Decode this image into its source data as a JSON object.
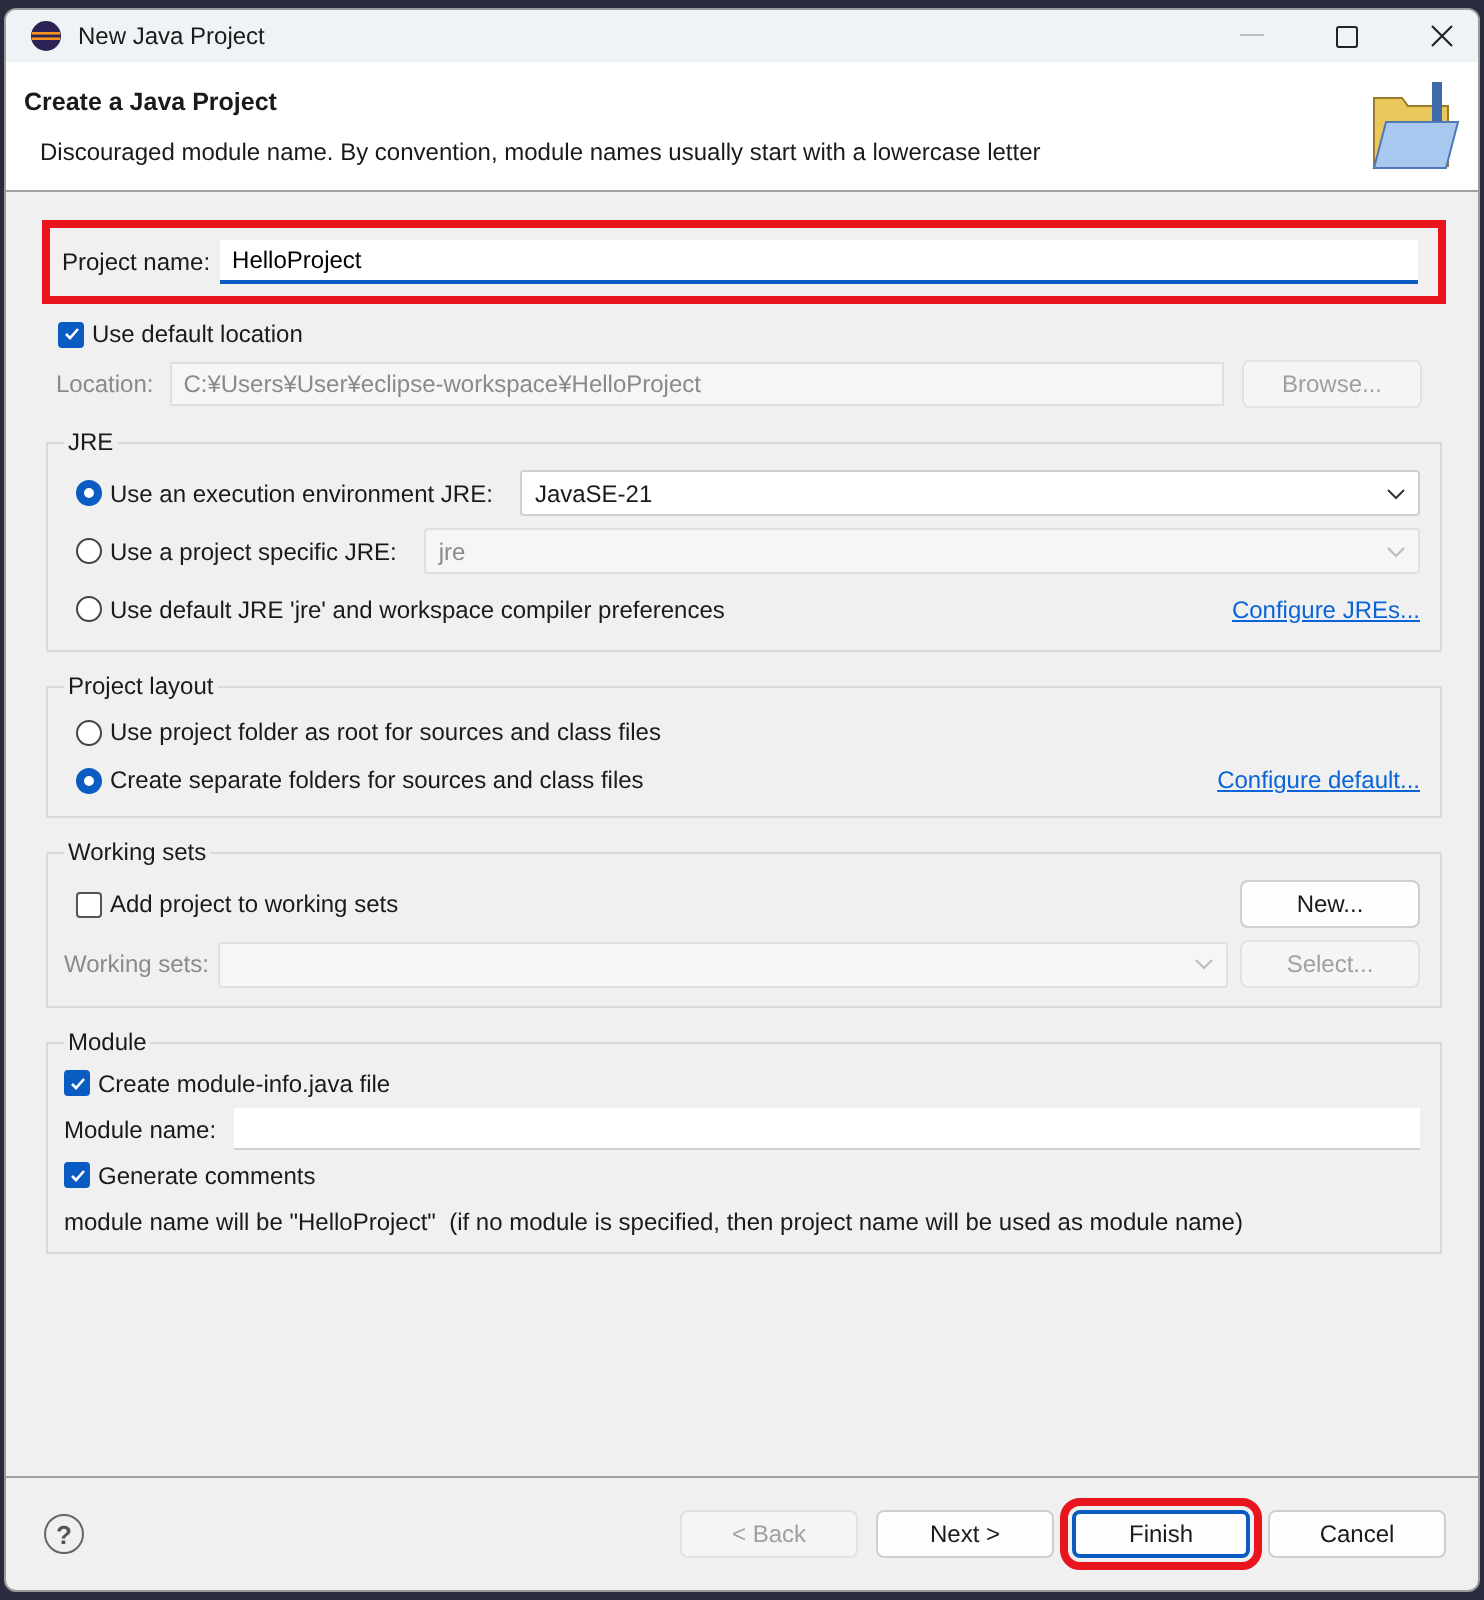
{
  "window": {
    "title": "New Java Project"
  },
  "header": {
    "title": "Create a Java Project",
    "message": "Discouraged module name. By convention, module names usually start with a lowercase letter"
  },
  "project_name": {
    "label": "Project name:",
    "value": "HelloProject",
    "highlighted": true
  },
  "default_location": {
    "label": "Use default location",
    "checked": true
  },
  "location": {
    "label": "Location:",
    "value": "C:¥Users¥User¥eclipse-workspace¥HelloProject",
    "disabled": true,
    "button": "Browse..."
  },
  "jre": {
    "title": "JRE",
    "options": [
      {
        "kind": "combo",
        "label": "Use an execution environment JRE:",
        "selected": true,
        "value": "JavaSE-21",
        "disabled": false
      },
      {
        "kind": "combo",
        "label": "Use a project specific JRE:",
        "selected": false,
        "value": "jre",
        "disabled": true
      },
      {
        "kind": "link",
        "label": "Use default JRE 'jre' and workspace compiler preferences",
        "selected": false,
        "link": "Configure JREs..."
      }
    ]
  },
  "layout": {
    "title": "Project layout",
    "options": [
      {
        "kind": "plain",
        "label": "Use project folder as root for sources and class files",
        "selected": false
      },
      {
        "kind": "link",
        "label": "Create separate folders for sources and class files",
        "selected": true,
        "link": "Configure default..."
      }
    ]
  },
  "working_sets": {
    "title": "Working sets",
    "add": {
      "label": "Add project to working sets",
      "checked": false
    },
    "new_button": "New...",
    "sets_label": "Working sets:",
    "disabled": true,
    "select_button": "Select..."
  },
  "module": {
    "title": "Module",
    "create": {
      "label": "Create module-info.java file",
      "checked": true
    },
    "name_label": "Module name:",
    "comments": {
      "label": "Generate comments",
      "checked": true
    },
    "note": "module name will be \"HelloProject\"  (if no module is specified, then project name will be used as module name)"
  },
  "help": "?",
  "buttons": [
    {
      "label": "< Back",
      "disabled": true,
      "default": false,
      "highlighted": false
    },
    {
      "label": "Next >",
      "disabled": false,
      "default": false,
      "highlighted": false
    },
    {
      "label": "Finish",
      "disabled": false,
      "default": true,
      "highlighted": true
    },
    {
      "label": "Cancel",
      "disabled": false,
      "default": false,
      "highlighted": false
    }
  ]
}
